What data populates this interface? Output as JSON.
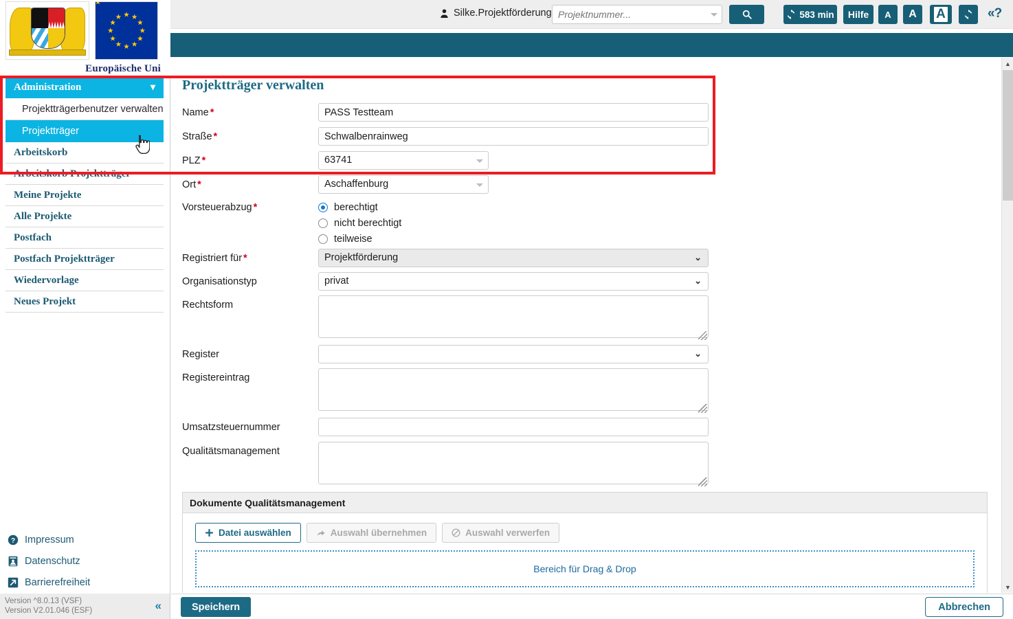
{
  "header": {
    "user_name": "Silke.Projektförderung",
    "user_icon": "user-icon",
    "search_placeholder": "Projektnummer...",
    "search_value": "",
    "search_button_icon": "search-icon",
    "timer_label": "583 min",
    "timer_icon": "refresh-icon",
    "help_label": "Hilfe",
    "font_small_label": "A",
    "font_medium_label": "A",
    "font_large_label": "A",
    "refresh_icon": "refresh-icon",
    "help_toggle_label": "«?"
  },
  "branding": {
    "eu_caption": "Europäische Uni",
    "coat_of_arms": "bavaria-coat-of-arms",
    "eu_flag": "eu-flag"
  },
  "sidebar": {
    "group": {
      "label": "Administration",
      "chevron": "chevron-down-icon",
      "items": [
        {
          "label": "Projektträgerbenutzer verwalten",
          "selected": false
        },
        {
          "label": "Projektträger",
          "selected": true
        }
      ]
    },
    "items": [
      {
        "label": "Arbeitskorb"
      },
      {
        "label": "Arbeitskorb Projektträger"
      },
      {
        "label": "Meine Projekte"
      },
      {
        "label": "Alle Projekte"
      },
      {
        "label": "Postfach"
      },
      {
        "label": "Postfach Projektträger"
      },
      {
        "label": "Wiedervorlage"
      },
      {
        "label": "Neues Projekt"
      }
    ],
    "footer_links": [
      {
        "label": "Impressum",
        "icon": "question-circle-icon"
      },
      {
        "label": "Datenschutz",
        "icon": "document-person-icon"
      },
      {
        "label": "Barrierefreiheit",
        "icon": "arrow-out-icon"
      }
    ],
    "version": "Version ^8.0.13 (VSF)\nVersion V2.01.046 (ESF)",
    "collapse_label": "«"
  },
  "main": {
    "title": "Projektträger verwalten",
    "fields": {
      "name": {
        "label": "Name",
        "required": true,
        "value": "PASS Testteam"
      },
      "strasse": {
        "label": "Straße",
        "required": true,
        "value": "Schwalbenrainweg"
      },
      "plz": {
        "label": "PLZ",
        "required": true,
        "value": "63741"
      },
      "ort": {
        "label": "Ort",
        "required": true,
        "value": "Aschaffenburg"
      },
      "vorsteuerabzug": {
        "label": "Vorsteuerabzug",
        "required": true,
        "options": [
          "berechtigt",
          "nicht berechtigt",
          "teilweise"
        ],
        "selected": "berechtigt"
      },
      "registriert_fuer": {
        "label": "Registriert für",
        "required": true,
        "value": "Projektförderung",
        "disabled": true
      },
      "organisationstyp": {
        "label": "Organisationstyp",
        "required": false,
        "value": "privat"
      },
      "rechtsform": {
        "label": "Rechtsform",
        "required": false,
        "value": ""
      },
      "register": {
        "label": "Register",
        "required": false,
        "value": ""
      },
      "registereintrag": {
        "label": "Registereintrag",
        "required": false,
        "value": ""
      },
      "umsatzsteuernummer": {
        "label": "Umsatzsteuernummer",
        "required": false,
        "value": ""
      },
      "qualitaetsmanagement": {
        "label": "Qualitätsmanagement",
        "required": false,
        "value": ""
      }
    },
    "documents_panel": {
      "title": "Dokumente Qualitätsmanagement",
      "buttons": [
        {
          "label": "Datei auswählen",
          "icon": "plus-icon",
          "disabled": false
        },
        {
          "label": "Auswahl übernehmen",
          "icon": "share-arrow-icon",
          "disabled": true
        },
        {
          "label": "Auswahl verwerfen",
          "icon": "no-entry-icon",
          "disabled": true
        }
      ],
      "dropzone_label": "Bereich für Drag & Drop"
    }
  },
  "actions": {
    "save_label": "Speichern",
    "cancel_label": "Abbrechen"
  },
  "scrollbar": {
    "up_icon": "chevron-up-icon",
    "down_icon": "chevron-down-icon"
  },
  "colors": {
    "teal": "#175f76",
    "cyan_highlight": "#0cb4e3",
    "required_red": "#d0021b",
    "annotation_red": "#ec1c24",
    "link_blue": "#1d6a85"
  }
}
